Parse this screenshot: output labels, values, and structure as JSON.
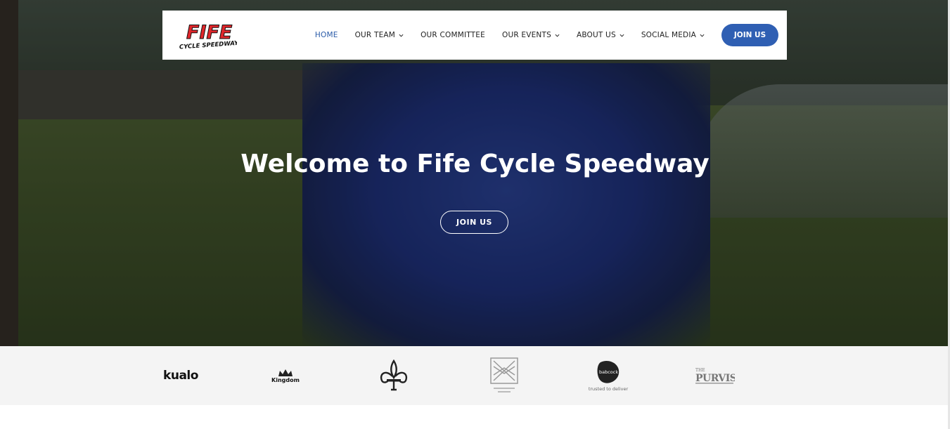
{
  "header": {
    "logo_text": "FIFE",
    "logo_subtext": "CYCLE SPEEDWAY",
    "nav": [
      {
        "label": "HOME",
        "active": true,
        "dropdown": false
      },
      {
        "label": "OUR TEAM",
        "active": false,
        "dropdown": true
      },
      {
        "label": "OUR COMMITTEE",
        "active": false,
        "dropdown": false
      },
      {
        "label": "OUR EVENTS",
        "active": false,
        "dropdown": true
      },
      {
        "label": "ABOUT US",
        "active": false,
        "dropdown": true
      },
      {
        "label": "SOCIAL MEDIA",
        "active": false,
        "dropdown": true
      }
    ],
    "join_label": "JOIN US"
  },
  "hero": {
    "title": "Welcome to Fife Cycle Speedway",
    "button_label": "JOIN US"
  },
  "sponsors": [
    {
      "name": "kualo",
      "text": "kualo",
      "icon": "kualo-logo"
    },
    {
      "name": "kingdom-fm",
      "text": "Kingdom",
      "icon": "crown-icon"
    },
    {
      "name": "scouts",
      "text": "",
      "icon": "fleur-de-lis-icon"
    },
    {
      "name": "trust",
      "text": "",
      "icon": "emblem-icon"
    },
    {
      "name": "babcock",
      "text": "babcock",
      "subtext": "trusted to deliver",
      "icon": "babcock-logo"
    },
    {
      "name": "purvis",
      "text": "THE PURVIS",
      "icon": "purvis-logo"
    }
  ],
  "colors": {
    "accent": "#2f5fb3",
    "nav_active": "#2a5ba8",
    "logo_red": "#e0262b",
    "sponsor_bg": "#f4f4f4"
  }
}
